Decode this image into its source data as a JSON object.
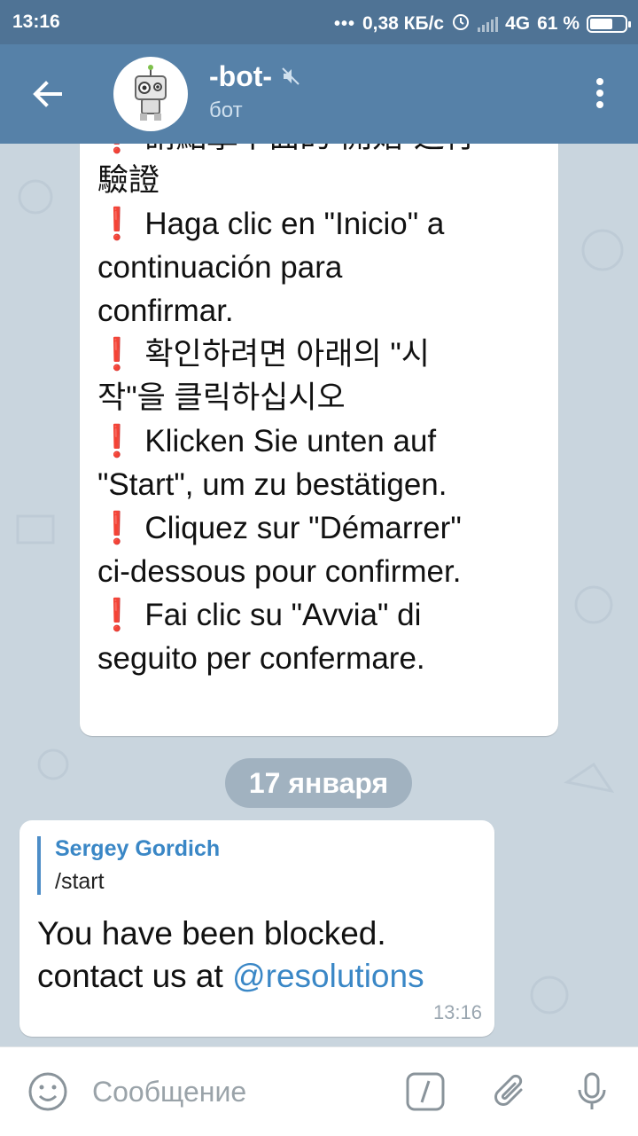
{
  "status_bar": {
    "time": "13:16",
    "dots": "•••",
    "network_speed": "0,38 КБ/с",
    "network_type": "4G",
    "battery": "61 %"
  },
  "header": {
    "title": "-bot-",
    "subtitle": "бот",
    "icons": [
      "back-arrow-icon",
      "bot-avatar",
      "muted-icon",
      "more-vertical-icon"
    ]
  },
  "bubble_large": {
    "lines": [
      "❗ 請點擊下面的“開始”進行",
      "驗證",
      "❗ Haga clic en \"Inicio\" a",
      "continuación para",
      "confirmar.",
      "❗ 확인하려면 아래의 \"시",
      "작\"을 클릭하십시오",
      "❗ Klicken Sie unten auf",
      "\"Start\", um zu bestätigen.",
      "❗ Cliquez sur \"Démarrer\"",
      "ci-dessous pour confirmer.",
      "❗ Fai clic su \"Avvia\" di",
      "seguito per confermare."
    ]
  },
  "date_divider": "17 января",
  "bubble_reply": {
    "reply_name": "Sergey Gordich",
    "reply_text": "/start",
    "message_line1": "You have been blocked.",
    "message_line2_prefix": "contact us at ",
    "message_link": "@resolutions",
    "time": "13:16"
  },
  "input": {
    "placeholder": "Сообщение",
    "icons": [
      "emoji-icon",
      "bot-command-icon",
      "attach-icon",
      "mic-icon"
    ]
  },
  "colors": {
    "header": "#5681a8",
    "status_bar": "#4f7395",
    "link": "#3a87c6",
    "exclamation": "#d0202a"
  }
}
